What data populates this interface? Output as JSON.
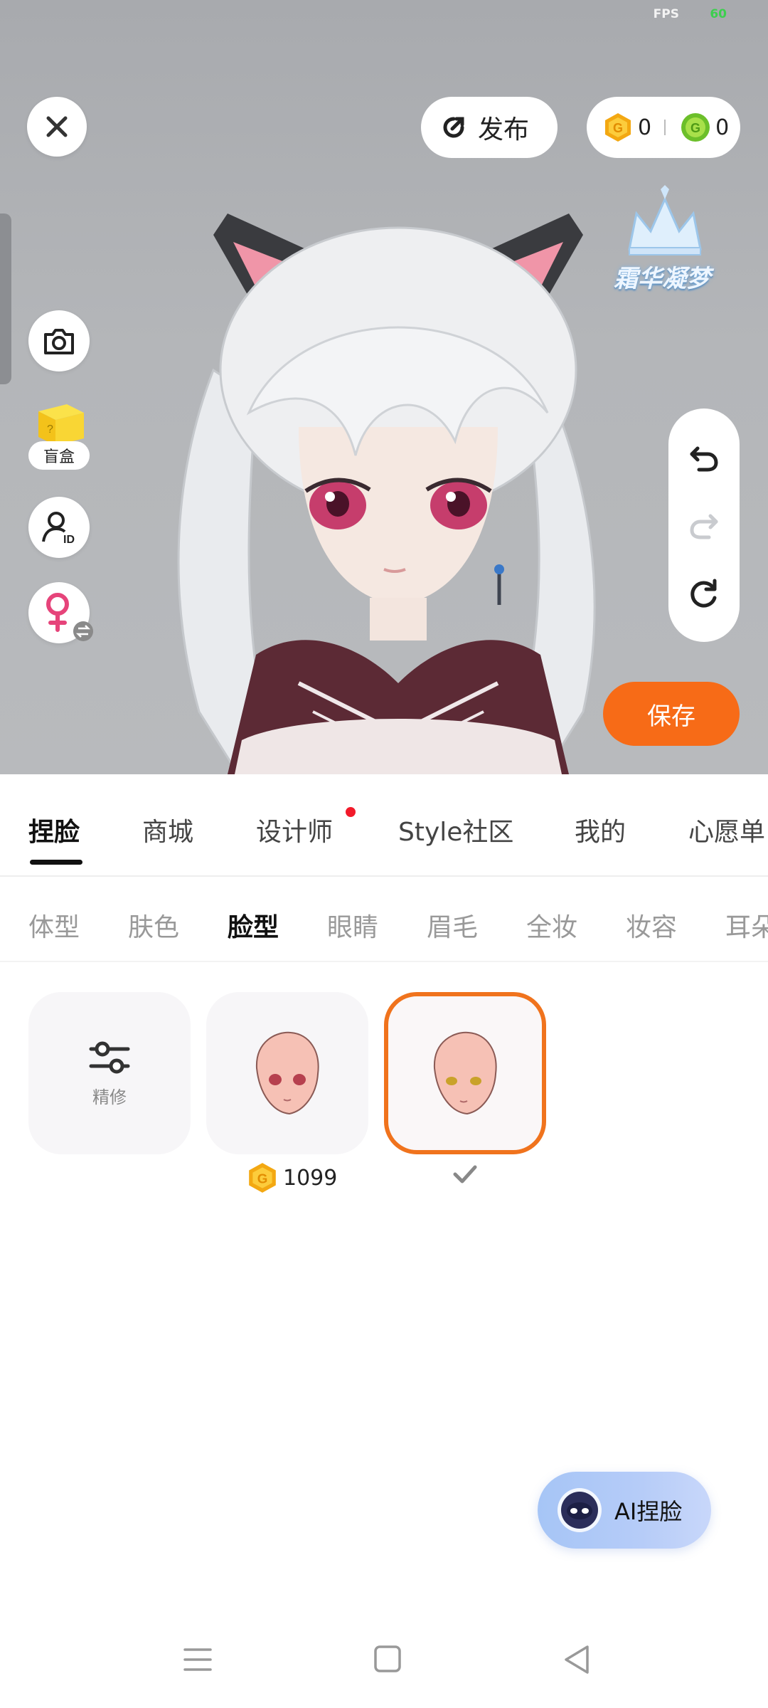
{
  "status": {
    "fps_label": "FPS",
    "fps_value": "60"
  },
  "top_bar": {
    "publish_label": "发布",
    "gold_coins": "0",
    "green_coins": "0"
  },
  "left_tools": {
    "blind_box_label": "盲盒"
  },
  "watermark": {
    "text": "霜华凝梦"
  },
  "save_label": "保存",
  "main_tabs": [
    {
      "label": "捏脸"
    },
    {
      "label": "商城"
    },
    {
      "label": "设计师"
    },
    {
      "label": "Style社区"
    },
    {
      "label": "我的"
    },
    {
      "label": "心愿单"
    }
  ],
  "sub_tabs": [
    {
      "label": "体型"
    },
    {
      "label": "肤色"
    },
    {
      "label": "脸型"
    },
    {
      "label": "眼睛"
    },
    {
      "label": "眉毛"
    },
    {
      "label": "全妆"
    },
    {
      "label": "妆容"
    },
    {
      "label": "耳朵"
    }
  ],
  "items": {
    "refine_label": "精修",
    "face1_price": "1099"
  },
  "ai_face_label": "AI捏脸",
  "colors": {
    "accent": "#f76b17",
    "selected_border": "#f0731d",
    "dot": "#f21a2a"
  }
}
